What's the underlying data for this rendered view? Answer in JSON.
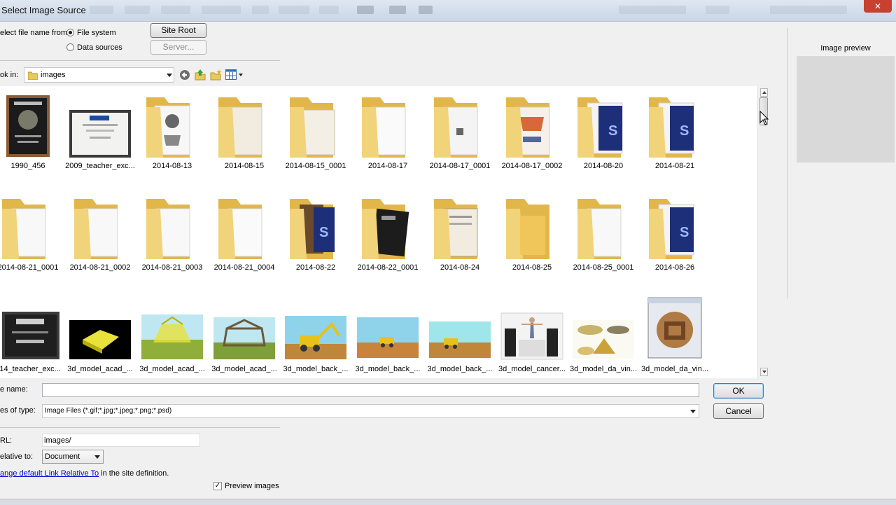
{
  "window": {
    "title": "Select Image Source",
    "close_glyph": "✕"
  },
  "source": {
    "label": "elect file name from:",
    "options": [
      {
        "label": "File system",
        "selected": true
      },
      {
        "label": "Data sources",
        "selected": false
      }
    ],
    "site_root_button": "Site Root",
    "server_button": "Server..."
  },
  "lookin": {
    "label": "ok in:",
    "value": "images"
  },
  "files": [
    {
      "name": "1990_456",
      "kind": "image",
      "icon": "plaque-image"
    },
    {
      "name": "2009_teacher_exc...",
      "kind": "image",
      "icon": "certificate-image"
    },
    {
      "name": "2014-08-13",
      "kind": "folder",
      "icon": "folder-icon"
    },
    {
      "name": "2014-08-15",
      "kind": "folder",
      "icon": "folder-icon"
    },
    {
      "name": "2014-08-15_0001",
      "kind": "folder",
      "icon": "folder-icon"
    },
    {
      "name": "2014-08-17",
      "kind": "folder",
      "icon": "folder-icon"
    },
    {
      "name": "2014-08-17_0001",
      "kind": "folder",
      "icon": "folder-icon"
    },
    {
      "name": "2014-08-17_0002",
      "kind": "folder",
      "icon": "folder-icon"
    },
    {
      "name": "2014-08-20",
      "kind": "folder",
      "icon": "folder-psd-icon"
    },
    {
      "name": "2014-08-21",
      "kind": "folder",
      "icon": "folder-psd-icon"
    },
    {
      "name": "2014-08-21_0001",
      "kind": "folder",
      "icon": "folder-icon"
    },
    {
      "name": "2014-08-21_0002",
      "kind": "folder",
      "icon": "folder-icon"
    },
    {
      "name": "2014-08-21_0003",
      "kind": "folder",
      "icon": "folder-icon"
    },
    {
      "name": "2014-08-21_0004",
      "kind": "folder",
      "icon": "folder-icon"
    },
    {
      "name": "2014-08-22",
      "kind": "folder",
      "icon": "folder-psd-icon"
    },
    {
      "name": "2014-08-22_0001",
      "kind": "folder",
      "icon": "folder-icon"
    },
    {
      "name": "2014-08-24",
      "kind": "folder",
      "icon": "folder-icon"
    },
    {
      "name": "2014-08-25",
      "kind": "folder",
      "icon": "folder-icon"
    },
    {
      "name": "2014-08-25_0001",
      "kind": "folder",
      "icon": "folder-icon"
    },
    {
      "name": "2014-08-26",
      "kind": "folder",
      "icon": "folder-psd-icon"
    },
    {
      "name": "014_teacher_exc...",
      "kind": "image",
      "icon": "plaque-image"
    },
    {
      "name": "3d_model_acad_...",
      "kind": "image",
      "icon": "3d-model-image"
    },
    {
      "name": "3d_model_acad_...",
      "kind": "image",
      "icon": "3d-model-image"
    },
    {
      "name": "3d_model_acad_...",
      "kind": "image",
      "icon": "3d-model-image"
    },
    {
      "name": "3d_model_back_...",
      "kind": "image",
      "icon": "3d-model-image"
    },
    {
      "name": "3d_model_back_...",
      "kind": "image",
      "icon": "3d-model-image"
    },
    {
      "name": "3d_model_back_...",
      "kind": "image",
      "icon": "3d-model-image"
    },
    {
      "name": "3d_model_cancer...",
      "kind": "image",
      "icon": "3d-model-image"
    },
    {
      "name": "3d_model_da_vin...",
      "kind": "image",
      "icon": "3d-model-image"
    },
    {
      "name": "3d_model_da_vin...",
      "kind": "image",
      "icon": "3d-model-image"
    }
  ],
  "filename": {
    "label": "e name:",
    "value": ""
  },
  "filetype": {
    "label": "es of type:",
    "value": "Image Files (*.gif;*.jpg;*.jpeg;*.png;*.psd)"
  },
  "buttons": {
    "ok": "OK",
    "cancel": "Cancel"
  },
  "url": {
    "label": "RL:",
    "value": "images/"
  },
  "relative": {
    "label": "elative to:",
    "value": "Document"
  },
  "change_link": {
    "link_text": "ange default Link Relative To",
    "suffix": " in the site definition."
  },
  "preview": {
    "label": "Image preview",
    "checkbox_label": "Preview images",
    "checked": true,
    "check_glyph": "✓"
  }
}
